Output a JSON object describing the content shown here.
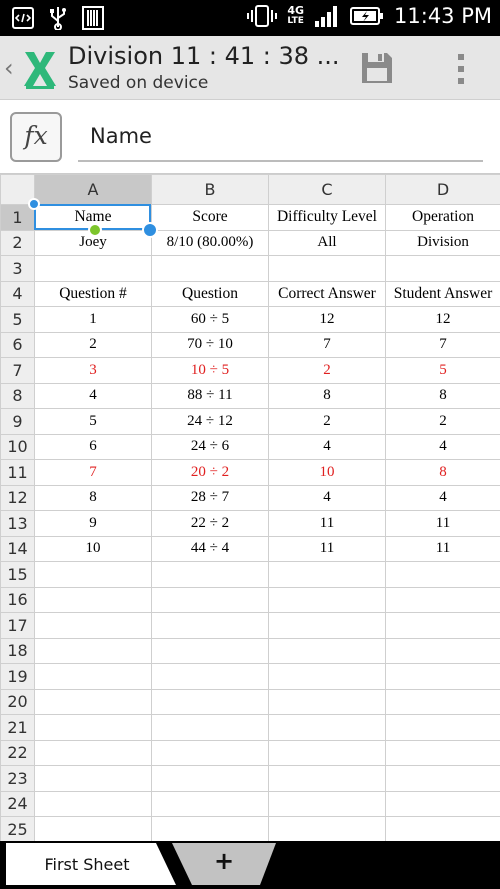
{
  "status_bar": {
    "time": "11:43 PM",
    "network_label": "4G",
    "network_sub": "LTE",
    "icons": [
      "code-icon",
      "usb-icon",
      "barcode-icon",
      "vibrate-icon",
      "signal-icon",
      "battery-charging-icon"
    ]
  },
  "action_bar": {
    "title": "Division 11 : 41 : 38 ...",
    "subtitle": "Saved on device",
    "accent_color": "#2eb87a"
  },
  "formula_bar": {
    "fx_label": "fx",
    "value": "Name"
  },
  "grid": {
    "columns": [
      "A",
      "B",
      "C",
      "D"
    ],
    "selected_column": "A",
    "selected_row": "1",
    "selected_cell": "A1",
    "rows": [
      {
        "num": "1",
        "cells": [
          "Name",
          "Score",
          "Difficulty Level",
          "Operation"
        ],
        "red": false
      },
      {
        "num": "2",
        "cells": [
          "Joey",
          "8/10 (80.00%)",
          "All",
          "Division"
        ],
        "red": false
      },
      {
        "num": "3",
        "cells": [
          "",
          "",
          "",
          ""
        ],
        "red": false
      },
      {
        "num": "4",
        "cells": [
          "Question #",
          "Question",
          "Correct Answer",
          "Student Answer"
        ],
        "red": false
      },
      {
        "num": "5",
        "cells": [
          "1",
          "60 ÷ 5",
          "12",
          "12"
        ],
        "red": false
      },
      {
        "num": "6",
        "cells": [
          "2",
          "70 ÷ 10",
          "7",
          "7"
        ],
        "red": false
      },
      {
        "num": "7",
        "cells": [
          "3",
          "10 ÷ 5",
          "2",
          "5"
        ],
        "red": true
      },
      {
        "num": "8",
        "cells": [
          "4",
          "88 ÷ 11",
          "8",
          "8"
        ],
        "red": false
      },
      {
        "num": "9",
        "cells": [
          "5",
          "24 ÷ 12",
          "2",
          "2"
        ],
        "red": false
      },
      {
        "num": "10",
        "cells": [
          "6",
          "24 ÷ 6",
          "4",
          "4"
        ],
        "red": false
      },
      {
        "num": "11",
        "cells": [
          "7",
          "20 ÷ 2",
          "10",
          "8"
        ],
        "red": true
      },
      {
        "num": "12",
        "cells": [
          "8",
          "28 ÷ 7",
          "4",
          "4"
        ],
        "red": false
      },
      {
        "num": "13",
        "cells": [
          "9",
          "22 ÷ 2",
          "11",
          "11"
        ],
        "red": false
      },
      {
        "num": "14",
        "cells": [
          "10",
          "44 ÷ 4",
          "11",
          "11"
        ],
        "red": false
      },
      {
        "num": "15",
        "cells": [
          "",
          "",
          "",
          ""
        ],
        "red": false
      },
      {
        "num": "16",
        "cells": [
          "",
          "",
          "",
          ""
        ],
        "red": false
      },
      {
        "num": "17",
        "cells": [
          "",
          "",
          "",
          ""
        ],
        "red": false
      },
      {
        "num": "18",
        "cells": [
          "",
          "",
          "",
          ""
        ],
        "red": false
      },
      {
        "num": "19",
        "cells": [
          "",
          "",
          "",
          ""
        ],
        "red": false
      },
      {
        "num": "20",
        "cells": [
          "",
          "",
          "",
          ""
        ],
        "red": false
      },
      {
        "num": "21",
        "cells": [
          "",
          "",
          "",
          ""
        ],
        "red": false
      },
      {
        "num": "22",
        "cells": [
          "",
          "",
          "",
          ""
        ],
        "red": false
      },
      {
        "num": "23",
        "cells": [
          "",
          "",
          "",
          ""
        ],
        "red": false
      },
      {
        "num": "24",
        "cells": [
          "",
          "",
          "",
          ""
        ],
        "red": false
      },
      {
        "num": "25",
        "cells": [
          "",
          "",
          "",
          ""
        ],
        "red": false
      }
    ],
    "error_color": "#e02020"
  },
  "sheet_tabs": {
    "active_tab": "First Sheet",
    "add_label": "+"
  }
}
